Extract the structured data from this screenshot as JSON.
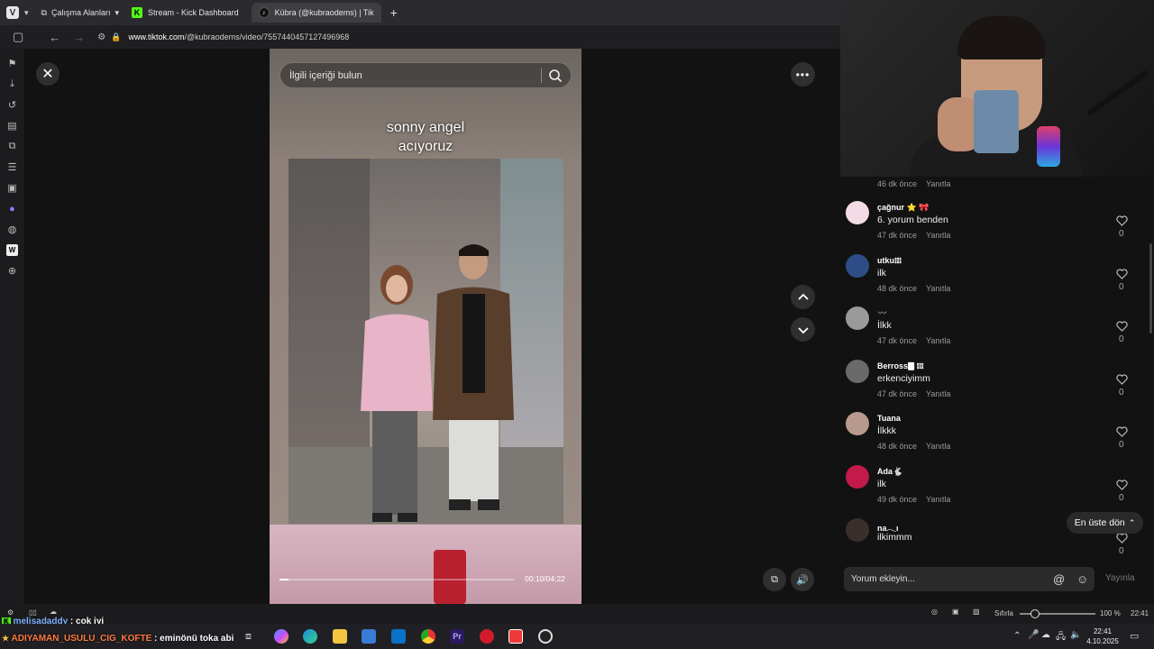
{
  "browser": {
    "workspaces_label": "Çalışma Alanları",
    "tabs": [
      {
        "label": "Stream - Kick Dashboard",
        "icon": "kick-icon"
      },
      {
        "label": "Kübra (@kubraodems) | Tik",
        "icon": "tiktok-icon"
      }
    ],
    "url_host": "www.tiktok.com",
    "url_path": "/@kubraodems/video/7557440457127496968"
  },
  "video": {
    "search_placeholder": "İlgili içeriği bulun",
    "caption_line1": "sonny angel",
    "caption_line2": "acıyoruz",
    "time": "00:10/04:22",
    "progress_fraction": 0.04
  },
  "comments": {
    "first_meta_time": "46 dk önce",
    "reply_label": "Yanıtla",
    "items": [
      {
        "name": "çağnur ⭐ 🎀",
        "text": "6. yorum benden",
        "time": "47 dk önce",
        "likes": "0",
        "avatar_color": "#f2dbe4"
      },
      {
        "name": "utku𝍖",
        "text": "ilk",
        "time": "48 dk önce",
        "likes": "0",
        "avatar_color": "#2e4d86"
      },
      {
        "name": "〰️",
        "text": "İlkk",
        "time": "47 dk önce",
        "likes": "0",
        "avatar_color": "#9a9a9a"
      },
      {
        "name": "Berross🀫 𝍖",
        "text": "erkenciyimm",
        "time": "47 dk önce",
        "likes": "0",
        "avatar_color": "#6a6a6a"
      },
      {
        "name": "Tuana",
        "text": "İlkkk",
        "time": "48 dk önce",
        "likes": "0",
        "avatar_color": "#b89a8c"
      },
      {
        "name": "Ada🐇",
        "text": "ilk",
        "time": "49 dk önce",
        "likes": "0",
        "avatar_color": "#c21a4a"
      },
      {
        "name": "na𓂃ı",
        "text": "ilkimmm",
        "time": "",
        "likes": "0",
        "avatar_color": "#3a2f2a"
      }
    ],
    "back_to_top": "En üste dön",
    "input_placeholder": "Yorum ekleyin...",
    "publish_label": "Yayınla"
  },
  "overlay_chat": [
    {
      "user": "melisadaddy",
      "message": " : çok iyi"
    },
    {
      "user": "ADIYAMAN_USULU_CIG_KOFTE",
      "message": " : eminönü toka abi"
    }
  ],
  "statusbar": {
    "reset_label": "Sıfırla",
    "zoom": "100 %",
    "clock_status": "22:41",
    "zoom_fraction": 0.2
  },
  "taskbar": {
    "time": "22:41",
    "date": "4.10.2025"
  },
  "colors": {
    "accent_kick": "#53fc18",
    "page_bg": "#121212"
  }
}
